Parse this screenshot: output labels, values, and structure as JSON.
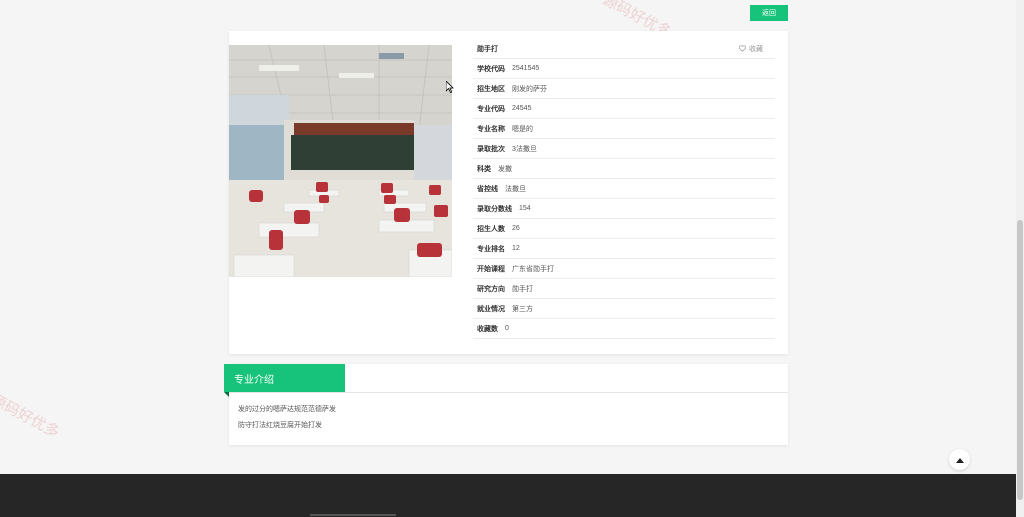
{
  "watermark": "源码好优多",
  "header": {
    "back_label": "返回"
  },
  "detail": {
    "name": "勋手打",
    "favorite_label": "收藏",
    "fields": [
      {
        "label": "学校代码",
        "value": "2541545"
      },
      {
        "label": "招生地区",
        "value": "刚发的萨芬"
      },
      {
        "label": "专业代码",
        "value": "24545"
      },
      {
        "label": "专业名称",
        "value": "嗯是的"
      },
      {
        "label": "录取批次",
        "value": "3法撒旦"
      },
      {
        "label": "科类",
        "value": "发撒"
      },
      {
        "label": "省控线",
        "value": "法撒旦"
      },
      {
        "label": "录取分数线",
        "value": "154"
      },
      {
        "label": "招生人数",
        "value": "26"
      },
      {
        "label": "专业排名",
        "value": "12"
      },
      {
        "label": "开始课程",
        "value": "广东省勋手打"
      },
      {
        "label": "研究方向",
        "value": "勋手打"
      },
      {
        "label": "就业情况",
        "value": "第三方"
      },
      {
        "label": "收藏数",
        "value": "0"
      }
    ]
  },
  "intro": {
    "title": "专业介绍",
    "lines": [
      "发的过分的嗯萨达规范范德萨发",
      "防守打法红烧豆腐开始打发"
    ]
  },
  "colors": {
    "accent": "#17c37a",
    "footer": "#262626"
  }
}
